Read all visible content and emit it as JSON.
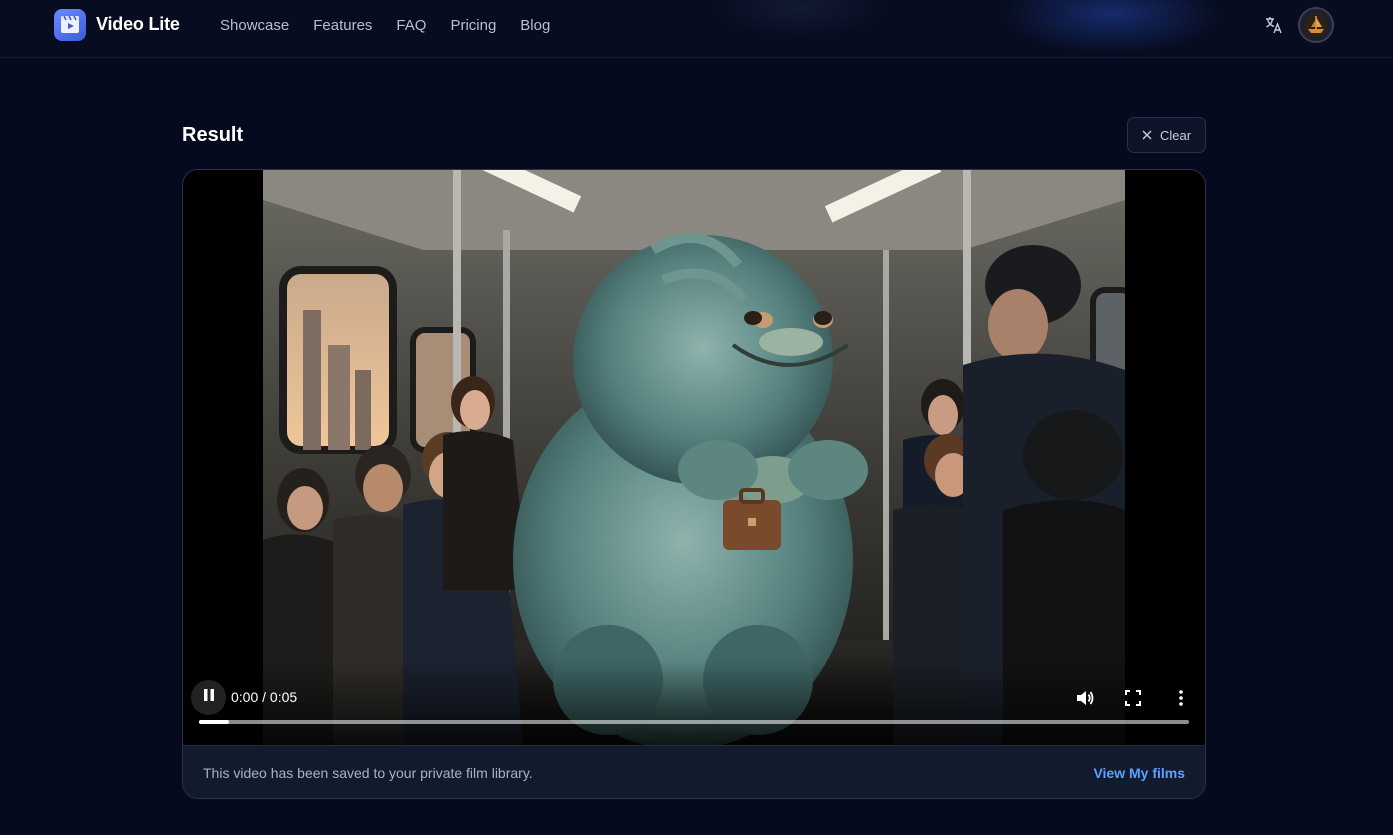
{
  "brand": {
    "name": "Video Lite"
  },
  "nav": {
    "links": [
      "Showcase",
      "Features",
      "FAQ",
      "Pricing",
      "Blog"
    ]
  },
  "result": {
    "title": "Result",
    "clear_label": "Clear"
  },
  "player": {
    "current_time": "0:00",
    "separator": "/",
    "duration": "0:05",
    "progress_fraction": 0.03
  },
  "footer": {
    "saved_text": "This video has been saved to your private film library.",
    "view_link": "View My films"
  },
  "colors": {
    "background": "#050a1e",
    "accent_link": "#5aa2ff",
    "logo_gradient_start": "#6b8cff",
    "logo_gradient_end": "#3b5bdb"
  },
  "icons": {
    "logo": "video-clapper-icon",
    "translate": "translate-icon",
    "clear": "close-icon",
    "play_state": "pause-icon",
    "volume": "volume-icon",
    "fullscreen": "fullscreen-icon",
    "more": "more-vertical-icon"
  }
}
